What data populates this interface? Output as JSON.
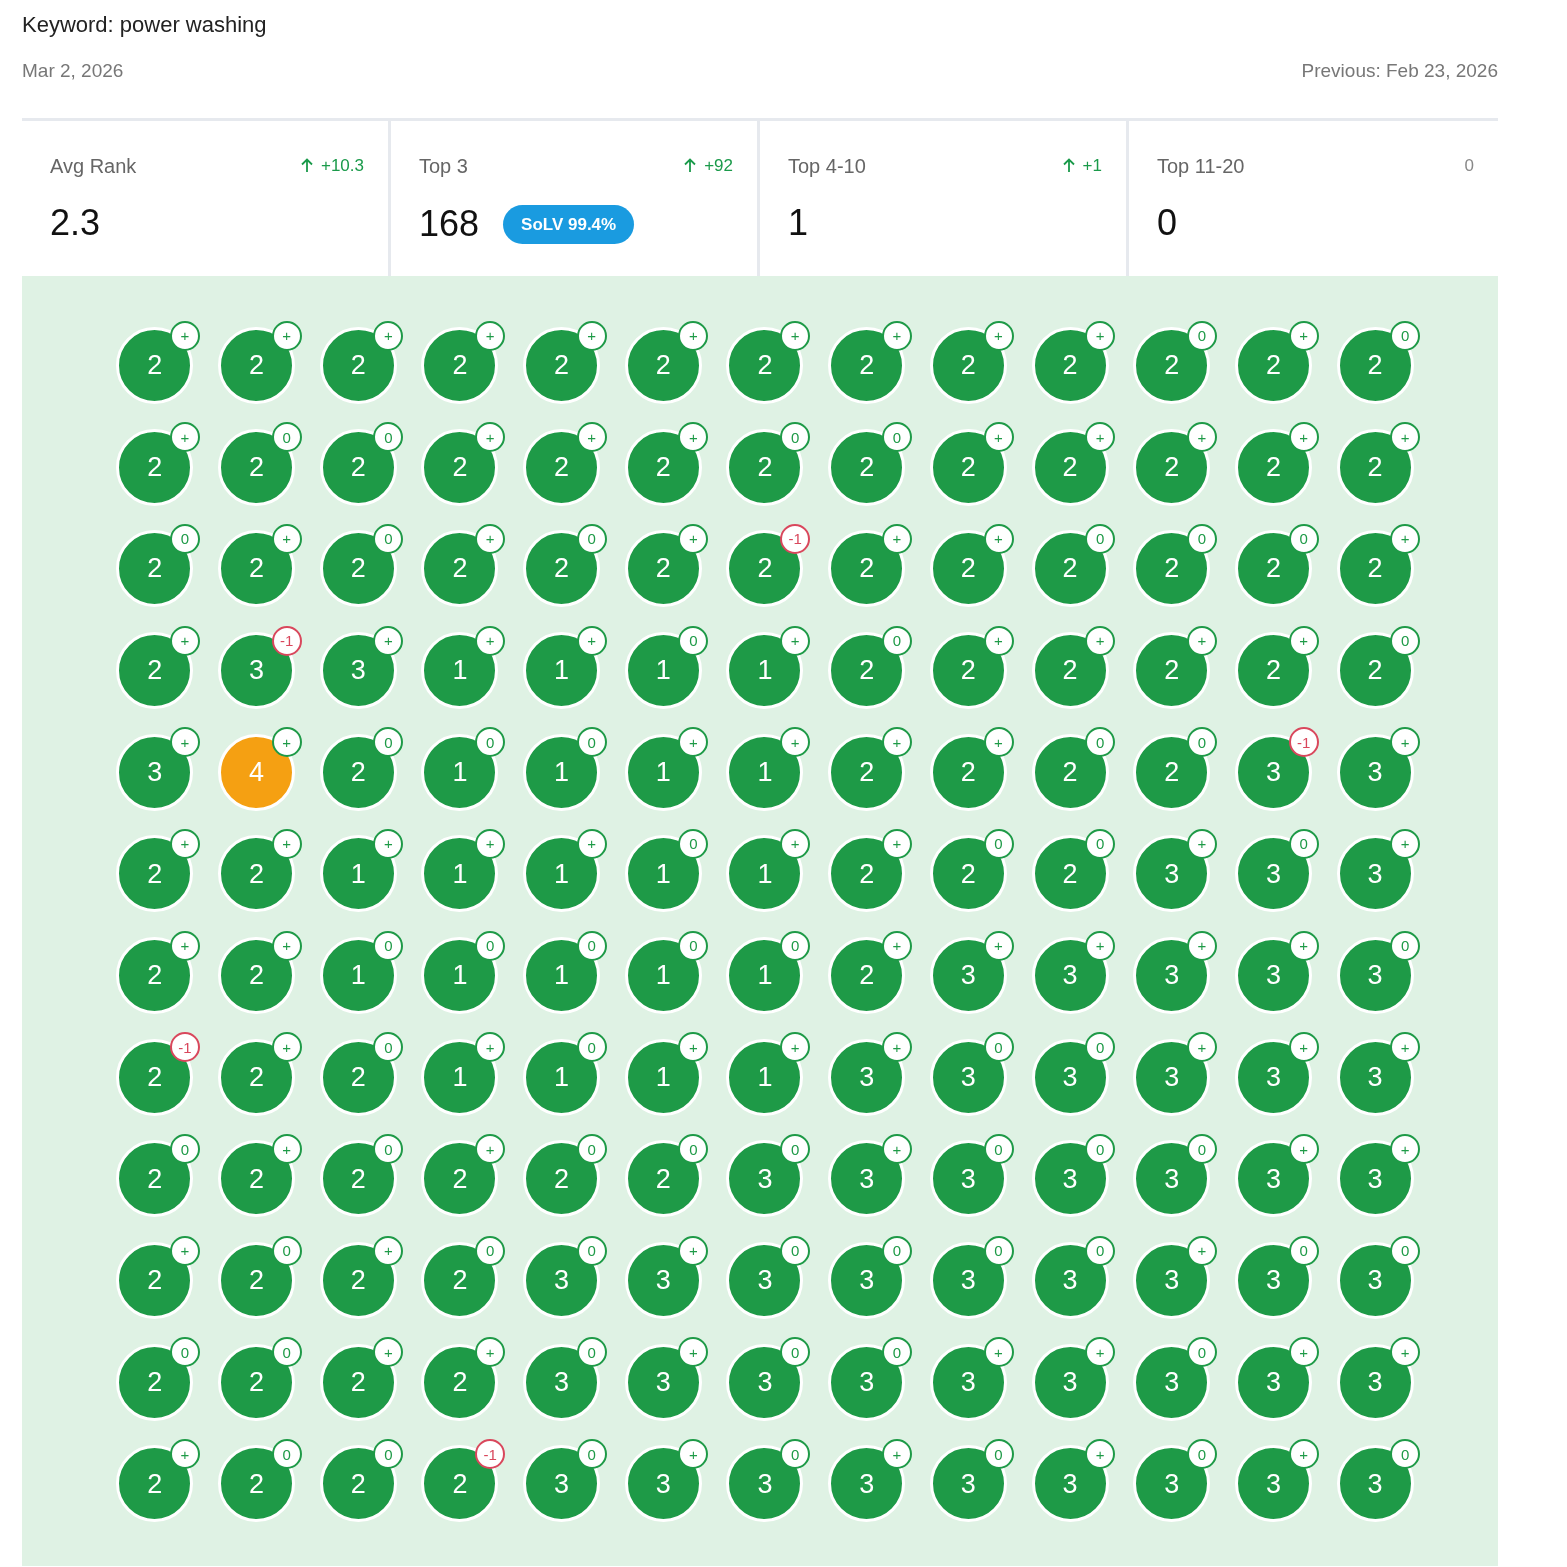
{
  "keyword": "Keyword: power washing",
  "date": "Mar 2, 2026",
  "previous": "Previous: Feb 23, 2026",
  "stats": [
    {
      "label": "Avg Rank",
      "change": "+10.3",
      "rising": true,
      "value": "2.3"
    },
    {
      "label": "Top 3",
      "change": "+92",
      "rising": true,
      "value": "168",
      "badge": "SoLV 99.4%"
    },
    {
      "label": "Top 4-10",
      "change": "+1",
      "rising": true,
      "value": "1"
    },
    {
      "label": "Top 11-20",
      "change": "0",
      "rising": false,
      "value": "0"
    }
  ],
  "grid": {
    "rows": [
      [
        {
          "rank": "2",
          "color": "#1e9a47",
          "delta": {
            "text": "+",
            "color": "#1e9a47"
          }
        },
        {
          "rank": "2",
          "color": "#1e9a47",
          "delta": {
            "text": "+",
            "color": "#1e9a47"
          }
        },
        {
          "rank": "2",
          "color": "#1e9a47",
          "delta": {
            "text": "+",
            "color": "#1e9a47"
          }
        },
        {
          "rank": "2",
          "color": "#1e9a47",
          "delta": {
            "text": "+",
            "color": "#1e9a47"
          }
        },
        {
          "rank": "2",
          "color": "#1e9a47",
          "delta": {
            "text": "+",
            "color": "#1e9a47"
          }
        },
        {
          "rank": "2",
          "color": "#1e9a47",
          "delta": {
            "text": "+",
            "color": "#1e9a47"
          }
        },
        {
          "rank": "2",
          "color": "#1e9a47",
          "delta": {
            "text": "+",
            "color": "#1e9a47"
          }
        },
        {
          "rank": "2",
          "color": "#1e9a47",
          "delta": {
            "text": "+",
            "color": "#1e9a47"
          }
        },
        {
          "rank": "2",
          "color": "#1e9a47",
          "delta": {
            "text": "+",
            "color": "#1e9a47"
          }
        },
        {
          "rank": "2",
          "color": "#1e9a47",
          "delta": {
            "text": "+",
            "color": "#1e9a47"
          }
        },
        {
          "rank": "2",
          "color": "#1e9a47",
          "delta": {
            "text": "0",
            "color": "#1e9a47"
          }
        },
        {
          "rank": "2",
          "color": "#1e9a47",
          "delta": {
            "text": "+",
            "color": "#1e9a47"
          }
        },
        {
          "rank": "2",
          "color": "#1e9a47",
          "delta": {
            "text": "0",
            "color": "#1e9a47"
          }
        }
      ],
      [
        {
          "rank": "2",
          "color": "#1e9a47",
          "delta": {
            "text": "+",
            "color": "#1e9a47"
          }
        },
        {
          "rank": "2",
          "color": "#1e9a47",
          "delta": {
            "text": "0",
            "color": "#1e9a47"
          }
        },
        {
          "rank": "2",
          "color": "#1e9a47",
          "delta": {
            "text": "0",
            "color": "#1e9a47"
          }
        },
        {
          "rank": "2",
          "color": "#1e9a47",
          "delta": {
            "text": "+",
            "color": "#1e9a47"
          }
        },
        {
          "rank": "2",
          "color": "#1e9a47",
          "delta": {
            "text": "+",
            "color": "#1e9a47"
          }
        },
        {
          "rank": "2",
          "color": "#1e9a47",
          "delta": {
            "text": "+",
            "color": "#1e9a47"
          }
        },
        {
          "rank": "2",
          "color": "#1e9a47",
          "delta": {
            "text": "0",
            "color": "#1e9a47"
          }
        },
        {
          "rank": "2",
          "color": "#1e9a47",
          "delta": {
            "text": "0",
            "color": "#1e9a47"
          }
        },
        {
          "rank": "2",
          "color": "#1e9a47",
          "delta": {
            "text": "+",
            "color": "#1e9a47"
          }
        },
        {
          "rank": "2",
          "color": "#1e9a47",
          "delta": {
            "text": "+",
            "color": "#1e9a47"
          }
        },
        {
          "rank": "2",
          "color": "#1e9a47",
          "delta": {
            "text": "+",
            "color": "#1e9a47"
          }
        },
        {
          "rank": "2",
          "color": "#1e9a47",
          "delta": {
            "text": "+",
            "color": "#1e9a47"
          }
        },
        {
          "rank": "2",
          "color": "#1e9a47",
          "delta": {
            "text": "+",
            "color": "#1e9a47"
          }
        }
      ],
      [
        {
          "rank": "2",
          "color": "#1e9a47",
          "delta": {
            "text": "0",
            "color": "#1e9a47"
          }
        },
        {
          "rank": "2",
          "color": "#1e9a47",
          "delta": {
            "text": "+",
            "color": "#1e9a47"
          }
        },
        {
          "rank": "2",
          "color": "#1e9a47",
          "delta": {
            "text": "0",
            "color": "#1e9a47"
          }
        },
        {
          "rank": "2",
          "color": "#1e9a47",
          "delta": {
            "text": "+",
            "color": "#1e9a47"
          }
        },
        {
          "rank": "2",
          "color": "#1e9a47",
          "delta": {
            "text": "0",
            "color": "#1e9a47"
          }
        },
        {
          "rank": "2",
          "color": "#1e9a47",
          "delta": {
            "text": "+",
            "color": "#1e9a47"
          }
        },
        {
          "rank": "2",
          "color": "#1e9a47",
          "delta": {
            "text": "-1",
            "color": "#d9475c"
          }
        },
        {
          "rank": "2",
          "color": "#1e9a47",
          "delta": {
            "text": "+",
            "color": "#1e9a47"
          }
        },
        {
          "rank": "2",
          "color": "#1e9a47",
          "delta": {
            "text": "+",
            "color": "#1e9a47"
          }
        },
        {
          "rank": "2",
          "color": "#1e9a47",
          "delta": {
            "text": "0",
            "color": "#1e9a47"
          }
        },
        {
          "rank": "2",
          "color": "#1e9a47",
          "delta": {
            "text": "0",
            "color": "#1e9a47"
          }
        },
        {
          "rank": "2",
          "color": "#1e9a47",
          "delta": {
            "text": "0",
            "color": "#1e9a47"
          }
        },
        {
          "rank": "2",
          "color": "#1e9a47",
          "delta": {
            "text": "+",
            "color": "#1e9a47"
          }
        }
      ],
      [
        {
          "rank": "2",
          "color": "#1e9a47",
          "delta": {
            "text": "+",
            "color": "#1e9a47"
          }
        },
        {
          "rank": "3",
          "color": "#1e9a47",
          "delta": {
            "text": "-1",
            "color": "#d9475c"
          }
        },
        {
          "rank": "3",
          "color": "#1e9a47",
          "delta": {
            "text": "+",
            "color": "#1e9a47"
          }
        },
        {
          "rank": "1",
          "color": "#1e9a47",
          "delta": {
            "text": "+",
            "color": "#1e9a47"
          }
        },
        {
          "rank": "1",
          "color": "#1e9a47",
          "delta": {
            "text": "+",
            "color": "#1e9a47"
          }
        },
        {
          "rank": "1",
          "color": "#1e9a47",
          "delta": {
            "text": "0",
            "color": "#1e9a47"
          }
        },
        {
          "rank": "1",
          "color": "#1e9a47",
          "delta": {
            "text": "+",
            "color": "#1e9a47"
          }
        },
        {
          "rank": "2",
          "color": "#1e9a47",
          "delta": {
            "text": "0",
            "color": "#1e9a47"
          }
        },
        {
          "rank": "2",
          "color": "#1e9a47",
          "delta": {
            "text": "+",
            "color": "#1e9a47"
          }
        },
        {
          "rank": "2",
          "color": "#1e9a47",
          "delta": {
            "text": "+",
            "color": "#1e9a47"
          }
        },
        {
          "rank": "2",
          "color": "#1e9a47",
          "delta": {
            "text": "+",
            "color": "#1e9a47"
          }
        },
        {
          "rank": "2",
          "color": "#1e9a47",
          "delta": {
            "text": "+",
            "color": "#1e9a47"
          }
        },
        {
          "rank": "2",
          "color": "#1e9a47",
          "delta": {
            "text": "0",
            "color": "#1e9a47"
          }
        }
      ],
      [
        {
          "rank": "3",
          "color": "#1e9a47",
          "delta": {
            "text": "+",
            "color": "#1e9a47"
          }
        },
        {
          "rank": "4",
          "color": "#f5a012",
          "delta": {
            "text": "+",
            "color": "#1e9a47"
          }
        },
        {
          "rank": "2",
          "color": "#1e9a47",
          "delta": {
            "text": "0",
            "color": "#1e9a47"
          }
        },
        {
          "rank": "1",
          "color": "#1e9a47",
          "delta": {
            "text": "0",
            "color": "#1e9a47"
          }
        },
        {
          "rank": "1",
          "color": "#1e9a47",
          "delta": {
            "text": "0",
            "color": "#1e9a47"
          }
        },
        {
          "rank": "1",
          "color": "#1e9a47",
          "delta": {
            "text": "+",
            "color": "#1e9a47"
          }
        },
        {
          "rank": "1",
          "color": "#1e9a47",
          "delta": {
            "text": "+",
            "color": "#1e9a47"
          }
        },
        {
          "rank": "2",
          "color": "#1e9a47",
          "delta": {
            "text": "+",
            "color": "#1e9a47"
          }
        },
        {
          "rank": "2",
          "color": "#1e9a47",
          "delta": {
            "text": "+",
            "color": "#1e9a47"
          }
        },
        {
          "rank": "2",
          "color": "#1e9a47",
          "delta": {
            "text": "0",
            "color": "#1e9a47"
          }
        },
        {
          "rank": "2",
          "color": "#1e9a47",
          "delta": {
            "text": "0",
            "color": "#1e9a47"
          }
        },
        {
          "rank": "3",
          "color": "#1e9a47",
          "delta": {
            "text": "-1",
            "color": "#d9475c"
          }
        },
        {
          "rank": "3",
          "color": "#1e9a47",
          "delta": {
            "text": "+",
            "color": "#1e9a47"
          }
        }
      ],
      [
        {
          "rank": "2",
          "color": "#1e9a47",
          "delta": {
            "text": "+",
            "color": "#1e9a47"
          }
        },
        {
          "rank": "2",
          "color": "#1e9a47",
          "delta": {
            "text": "+",
            "color": "#1e9a47"
          }
        },
        {
          "rank": "1",
          "color": "#1e9a47",
          "delta": {
            "text": "+",
            "color": "#1e9a47"
          }
        },
        {
          "rank": "1",
          "color": "#1e9a47",
          "delta": {
            "text": "+",
            "color": "#1e9a47"
          }
        },
        {
          "rank": "1",
          "color": "#1e9a47",
          "delta": {
            "text": "+",
            "color": "#1e9a47"
          }
        },
        {
          "rank": "1",
          "color": "#1e9a47",
          "delta": {
            "text": "0",
            "color": "#1e9a47"
          }
        },
        {
          "rank": "1",
          "color": "#1e9a47",
          "delta": {
            "text": "+",
            "color": "#1e9a47"
          }
        },
        {
          "rank": "2",
          "color": "#1e9a47",
          "delta": {
            "text": "+",
            "color": "#1e9a47"
          }
        },
        {
          "rank": "2",
          "color": "#1e9a47",
          "delta": {
            "text": "0",
            "color": "#1e9a47"
          }
        },
        {
          "rank": "2",
          "color": "#1e9a47",
          "delta": {
            "text": "0",
            "color": "#1e9a47"
          }
        },
        {
          "rank": "3",
          "color": "#1e9a47",
          "delta": {
            "text": "+",
            "color": "#1e9a47"
          }
        },
        {
          "rank": "3",
          "color": "#1e9a47",
          "delta": {
            "text": "0",
            "color": "#1e9a47"
          }
        },
        {
          "rank": "3",
          "color": "#1e9a47",
          "delta": {
            "text": "+",
            "color": "#1e9a47"
          }
        }
      ],
      [
        {
          "rank": "2",
          "color": "#1e9a47",
          "delta": {
            "text": "+",
            "color": "#1e9a47"
          }
        },
        {
          "rank": "2",
          "color": "#1e9a47",
          "delta": {
            "text": "+",
            "color": "#1e9a47"
          }
        },
        {
          "rank": "1",
          "color": "#1e9a47",
          "delta": {
            "text": "0",
            "color": "#1e9a47"
          }
        },
        {
          "rank": "1",
          "color": "#1e9a47",
          "delta": {
            "text": "0",
            "color": "#1e9a47"
          }
        },
        {
          "rank": "1",
          "color": "#1e9a47",
          "delta": {
            "text": "0",
            "color": "#1e9a47"
          }
        },
        {
          "rank": "1",
          "color": "#1e9a47",
          "delta": {
            "text": "0",
            "color": "#1e9a47"
          }
        },
        {
          "rank": "1",
          "color": "#1e9a47",
          "delta": {
            "text": "0",
            "color": "#1e9a47"
          }
        },
        {
          "rank": "2",
          "color": "#1e9a47",
          "delta": {
            "text": "+",
            "color": "#1e9a47"
          }
        },
        {
          "rank": "3",
          "color": "#1e9a47",
          "delta": {
            "text": "+",
            "color": "#1e9a47"
          }
        },
        {
          "rank": "3",
          "color": "#1e9a47",
          "delta": {
            "text": "+",
            "color": "#1e9a47"
          }
        },
        {
          "rank": "3",
          "color": "#1e9a47",
          "delta": {
            "text": "+",
            "color": "#1e9a47"
          }
        },
        {
          "rank": "3",
          "color": "#1e9a47",
          "delta": {
            "text": "+",
            "color": "#1e9a47"
          }
        },
        {
          "rank": "3",
          "color": "#1e9a47",
          "delta": {
            "text": "0",
            "color": "#1e9a47"
          }
        }
      ],
      [
        {
          "rank": "2",
          "color": "#1e9a47",
          "delta": {
            "text": "-1",
            "color": "#d9475c"
          }
        },
        {
          "rank": "2",
          "color": "#1e9a47",
          "delta": {
            "text": "+",
            "color": "#1e9a47"
          }
        },
        {
          "rank": "2",
          "color": "#1e9a47",
          "delta": {
            "text": "0",
            "color": "#1e9a47"
          }
        },
        {
          "rank": "1",
          "color": "#1e9a47",
          "delta": {
            "text": "+",
            "color": "#1e9a47"
          }
        },
        {
          "rank": "1",
          "color": "#1e9a47",
          "delta": {
            "text": "0",
            "color": "#1e9a47"
          }
        },
        {
          "rank": "1",
          "color": "#1e9a47",
          "delta": {
            "text": "+",
            "color": "#1e9a47"
          }
        },
        {
          "rank": "1",
          "color": "#1e9a47",
          "delta": {
            "text": "+",
            "color": "#1e9a47"
          }
        },
        {
          "rank": "3",
          "color": "#1e9a47",
          "delta": {
            "text": "+",
            "color": "#1e9a47"
          }
        },
        {
          "rank": "3",
          "color": "#1e9a47",
          "delta": {
            "text": "0",
            "color": "#1e9a47"
          }
        },
        {
          "rank": "3",
          "color": "#1e9a47",
          "delta": {
            "text": "0",
            "color": "#1e9a47"
          }
        },
        {
          "rank": "3",
          "color": "#1e9a47",
          "delta": {
            "text": "+",
            "color": "#1e9a47"
          }
        },
        {
          "rank": "3",
          "color": "#1e9a47",
          "delta": {
            "text": "+",
            "color": "#1e9a47"
          }
        },
        {
          "rank": "3",
          "color": "#1e9a47",
          "delta": {
            "text": "+",
            "color": "#1e9a47"
          }
        }
      ],
      [
        {
          "rank": "2",
          "color": "#1e9a47",
          "delta": {
            "text": "0",
            "color": "#1e9a47"
          }
        },
        {
          "rank": "2",
          "color": "#1e9a47",
          "delta": {
            "text": "+",
            "color": "#1e9a47"
          }
        },
        {
          "rank": "2",
          "color": "#1e9a47",
          "delta": {
            "text": "0",
            "color": "#1e9a47"
          }
        },
        {
          "rank": "2",
          "color": "#1e9a47",
          "delta": {
            "text": "+",
            "color": "#1e9a47"
          }
        },
        {
          "rank": "2",
          "color": "#1e9a47",
          "delta": {
            "text": "0",
            "color": "#1e9a47"
          }
        },
        {
          "rank": "2",
          "color": "#1e9a47",
          "delta": {
            "text": "0",
            "color": "#1e9a47"
          }
        },
        {
          "rank": "3",
          "color": "#1e9a47",
          "delta": {
            "text": "0",
            "color": "#1e9a47"
          }
        },
        {
          "rank": "3",
          "color": "#1e9a47",
          "delta": {
            "text": "+",
            "color": "#1e9a47"
          }
        },
        {
          "rank": "3",
          "color": "#1e9a47",
          "delta": {
            "text": "0",
            "color": "#1e9a47"
          }
        },
        {
          "rank": "3",
          "color": "#1e9a47",
          "delta": {
            "text": "0",
            "color": "#1e9a47"
          }
        },
        {
          "rank": "3",
          "color": "#1e9a47",
          "delta": {
            "text": "0",
            "color": "#1e9a47"
          }
        },
        {
          "rank": "3",
          "color": "#1e9a47",
          "delta": {
            "text": "+",
            "color": "#1e9a47"
          }
        },
        {
          "rank": "3",
          "color": "#1e9a47",
          "delta": {
            "text": "+",
            "color": "#1e9a47"
          }
        }
      ],
      [
        {
          "rank": "2",
          "color": "#1e9a47",
          "delta": {
            "text": "+",
            "color": "#1e9a47"
          }
        },
        {
          "rank": "2",
          "color": "#1e9a47",
          "delta": {
            "text": "0",
            "color": "#1e9a47"
          }
        },
        {
          "rank": "2",
          "color": "#1e9a47",
          "delta": {
            "text": "+",
            "color": "#1e9a47"
          }
        },
        {
          "rank": "2",
          "color": "#1e9a47",
          "delta": {
            "text": "0",
            "color": "#1e9a47"
          }
        },
        {
          "rank": "3",
          "color": "#1e9a47",
          "delta": {
            "text": "0",
            "color": "#1e9a47"
          }
        },
        {
          "rank": "3",
          "color": "#1e9a47",
          "delta": {
            "text": "+",
            "color": "#1e9a47"
          }
        },
        {
          "rank": "3",
          "color": "#1e9a47",
          "delta": {
            "text": "0",
            "color": "#1e9a47"
          }
        },
        {
          "rank": "3",
          "color": "#1e9a47",
          "delta": {
            "text": "0",
            "color": "#1e9a47"
          }
        },
        {
          "rank": "3",
          "color": "#1e9a47",
          "delta": {
            "text": "0",
            "color": "#1e9a47"
          }
        },
        {
          "rank": "3",
          "color": "#1e9a47",
          "delta": {
            "text": "0",
            "color": "#1e9a47"
          }
        },
        {
          "rank": "3",
          "color": "#1e9a47",
          "delta": {
            "text": "+",
            "color": "#1e9a47"
          }
        },
        {
          "rank": "3",
          "color": "#1e9a47",
          "delta": {
            "text": "0",
            "color": "#1e9a47"
          }
        },
        {
          "rank": "3",
          "color": "#1e9a47",
          "delta": {
            "text": "0",
            "color": "#1e9a47"
          }
        }
      ],
      [
        {
          "rank": "2",
          "color": "#1e9a47",
          "delta": {
            "text": "0",
            "color": "#1e9a47"
          }
        },
        {
          "rank": "2",
          "color": "#1e9a47",
          "delta": {
            "text": "0",
            "color": "#1e9a47"
          }
        },
        {
          "rank": "2",
          "color": "#1e9a47",
          "delta": {
            "text": "+",
            "color": "#1e9a47"
          }
        },
        {
          "rank": "2",
          "color": "#1e9a47",
          "delta": {
            "text": "+",
            "color": "#1e9a47"
          }
        },
        {
          "rank": "3",
          "color": "#1e9a47",
          "delta": {
            "text": "0",
            "color": "#1e9a47"
          }
        },
        {
          "rank": "3",
          "color": "#1e9a47",
          "delta": {
            "text": "+",
            "color": "#1e9a47"
          }
        },
        {
          "rank": "3",
          "color": "#1e9a47",
          "delta": {
            "text": "0",
            "color": "#1e9a47"
          }
        },
        {
          "rank": "3",
          "color": "#1e9a47",
          "delta": {
            "text": "0",
            "color": "#1e9a47"
          }
        },
        {
          "rank": "3",
          "color": "#1e9a47",
          "delta": {
            "text": "+",
            "color": "#1e9a47"
          }
        },
        {
          "rank": "3",
          "color": "#1e9a47",
          "delta": {
            "text": "+",
            "color": "#1e9a47"
          }
        },
        {
          "rank": "3",
          "color": "#1e9a47",
          "delta": {
            "text": "0",
            "color": "#1e9a47"
          }
        },
        {
          "rank": "3",
          "color": "#1e9a47",
          "delta": {
            "text": "+",
            "color": "#1e9a47"
          }
        },
        {
          "rank": "3",
          "color": "#1e9a47",
          "delta": {
            "text": "+",
            "color": "#1e9a47"
          }
        }
      ],
      [
        {
          "rank": "2",
          "color": "#1e9a47",
          "delta": {
            "text": "+",
            "color": "#1e9a47"
          }
        },
        {
          "rank": "2",
          "color": "#1e9a47",
          "delta": {
            "text": "0",
            "color": "#1e9a47"
          }
        },
        {
          "rank": "2",
          "color": "#1e9a47",
          "delta": {
            "text": "0",
            "color": "#1e9a47"
          }
        },
        {
          "rank": "2",
          "color": "#1e9a47",
          "delta": {
            "text": "-1",
            "color": "#d9475c"
          }
        },
        {
          "rank": "3",
          "color": "#1e9a47",
          "delta": {
            "text": "0",
            "color": "#1e9a47"
          }
        },
        {
          "rank": "3",
          "color": "#1e9a47",
          "delta": {
            "text": "+",
            "color": "#1e9a47"
          }
        },
        {
          "rank": "3",
          "color": "#1e9a47",
          "delta": {
            "text": "0",
            "color": "#1e9a47"
          }
        },
        {
          "rank": "3",
          "color": "#1e9a47",
          "delta": {
            "text": "+",
            "color": "#1e9a47"
          }
        },
        {
          "rank": "3",
          "color": "#1e9a47",
          "delta": {
            "text": "0",
            "color": "#1e9a47"
          }
        },
        {
          "rank": "3",
          "color": "#1e9a47",
          "delta": {
            "text": "+",
            "color": "#1e9a47"
          }
        },
        {
          "rank": "3",
          "color": "#1e9a47",
          "delta": {
            "text": "0",
            "color": "#1e9a47"
          }
        },
        {
          "rank": "3",
          "color": "#1e9a47",
          "delta": {
            "text": "+",
            "color": "#1e9a47"
          }
        },
        {
          "rank": "3",
          "color": "#1e9a47",
          "delta": {
            "text": "0",
            "color": "#1e9a47"
          }
        }
      ]
    ]
  }
}
